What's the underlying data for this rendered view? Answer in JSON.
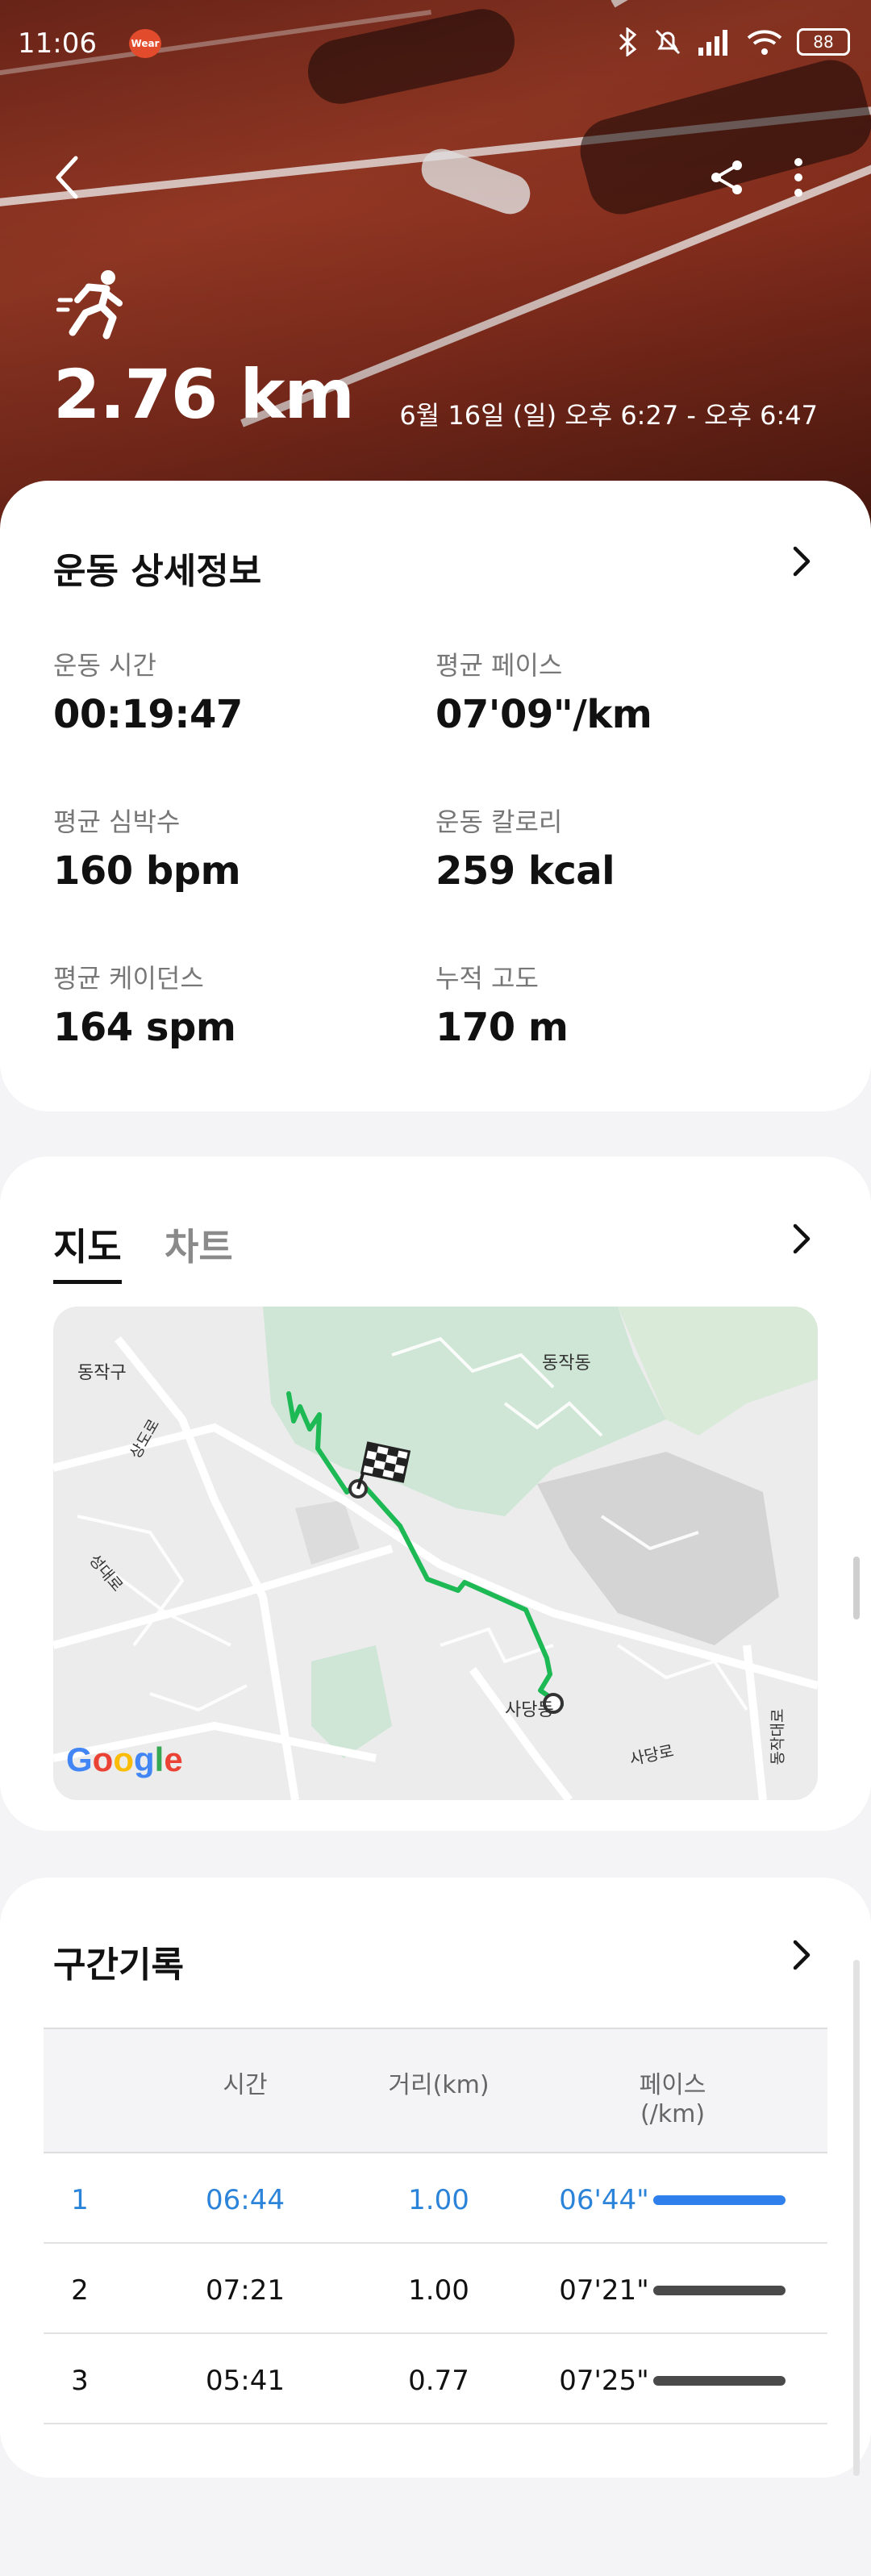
{
  "status_bar": {
    "time": "11:06",
    "wear_badge": "Wear",
    "battery": "88"
  },
  "header": {
    "distance": "2.76 km",
    "date_range": "6월 16일 (일) 오후 6:27 - 오후 6:47"
  },
  "details": {
    "title": "운동 상세정보",
    "stats": [
      {
        "label": "운동 시간",
        "value": "00:19:47"
      },
      {
        "label": "평균 페이스",
        "value": "07'09\"/km"
      },
      {
        "label": "평균 심박수",
        "value": "160 bpm"
      },
      {
        "label": "운동 칼로리",
        "value": "259 kcal"
      },
      {
        "label": "평균 케이던스",
        "value": "164 spm"
      },
      {
        "label": "누적 고도",
        "value": "170 m"
      }
    ]
  },
  "map_section": {
    "tabs": [
      {
        "label": "지도",
        "active": true
      },
      {
        "label": "차트",
        "active": false
      }
    ],
    "labels": {
      "dongjak_gu": "동작구",
      "dongjak_dong": "동작동",
      "sangdo_ro": "상도로",
      "seongdae_ro": "성대로",
      "sadang": "사당동",
      "sadang_ro": "사당로",
      "dongjak_daero": "동작대로",
      "google": "Google"
    }
  },
  "splits": {
    "title": "구간기록",
    "columns": [
      "시간",
      "거리(km)",
      "페이스",
      "(/km)"
    ],
    "rows": [
      {
        "num": "1",
        "time": "06:44",
        "distance": "1.00",
        "pace": "06'44\"",
        "highlight": true
      },
      {
        "num": "2",
        "time": "07:21",
        "distance": "1.00",
        "pace": "07'21\"",
        "highlight": false
      },
      {
        "num": "3",
        "time": "05:41",
        "distance": "0.77",
        "pace": "07'25\"",
        "highlight": false
      }
    ]
  },
  "colors": {
    "accent_blue": "#2f80ed",
    "route_green": "#1db954",
    "track_red": "#8a2f1e"
  }
}
